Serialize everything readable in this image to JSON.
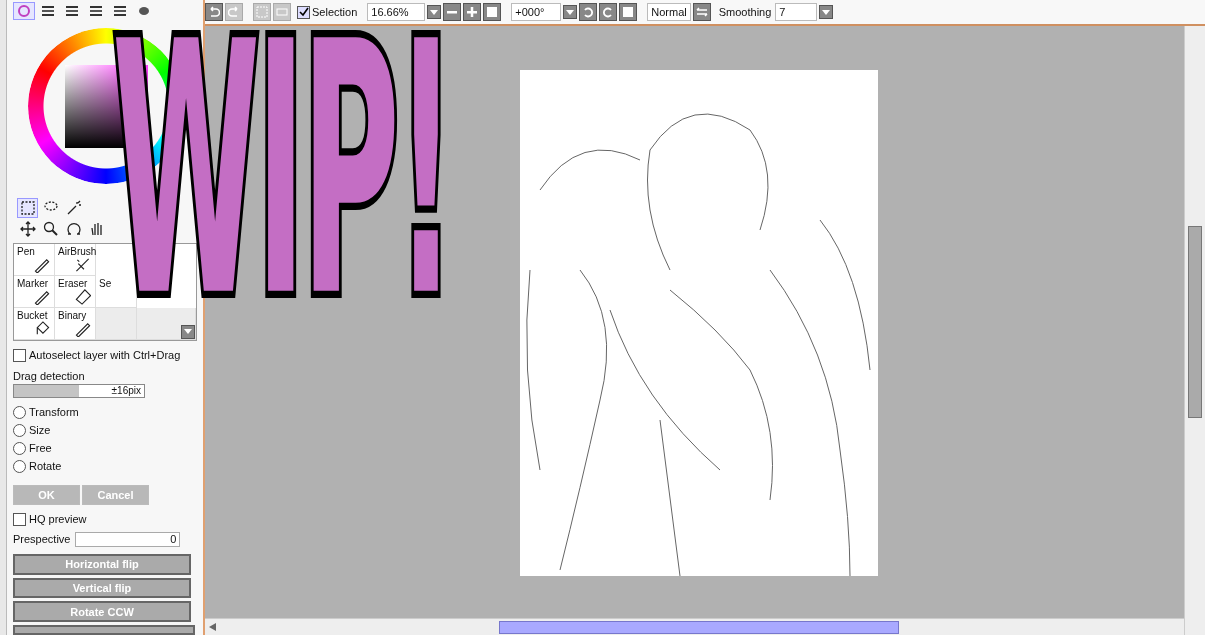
{
  "overlay": {
    "text": "WIP!"
  },
  "color_tabs": [
    {
      "selected": true
    },
    {
      "selected": false
    },
    {
      "selected": false
    },
    {
      "selected": false
    },
    {
      "selected": false
    },
    {
      "selected": false
    }
  ],
  "select_tools": [
    {
      "selected": true
    },
    {
      "selected": false
    },
    {
      "selected": false
    },
    {
      "selected": false
    },
    {
      "selected": false
    },
    {
      "selected": false
    },
    {
      "selected": false
    }
  ],
  "brushes": [
    {
      "label": "Pen",
      "kind": "pen"
    },
    {
      "label": "AirBrush",
      "kind": "airbrush"
    },
    {
      "kind": "none"
    },
    {
      "kind": "none"
    },
    {
      "label": "Marker",
      "kind": "marker"
    },
    {
      "label": "Eraser",
      "kind": "eraser"
    },
    {
      "label": "Se",
      "kind": "none"
    },
    {
      "kind": "none"
    },
    {
      "label": "Bucket",
      "kind": "bucket"
    },
    {
      "label": "Binary",
      "kind": "binary"
    },
    {
      "kind": "empty"
    },
    {
      "kind": "empty"
    }
  ],
  "autoselect": {
    "label": "Autoselect layer with Ctrl+Drag",
    "checked": false
  },
  "drag_detection": {
    "label": "Drag detection",
    "level": 0.5,
    "reading": "±16pix"
  },
  "modes": [
    {
      "label": "Transform",
      "selected": false
    },
    {
      "label": "Size",
      "selected": false
    },
    {
      "label": "Free",
      "selected": false
    },
    {
      "label": "Rotate",
      "selected": false
    }
  ],
  "confirm_buttons": [
    {
      "label": "OK",
      "disabled": true
    },
    {
      "label": "Cancel",
      "disabled": true
    }
  ],
  "hq_preview": {
    "label": "HQ preview",
    "checked": false
  },
  "perspective": {
    "label": "Prespective",
    "value": "0"
  },
  "action_buttons": [
    "Horizontal flip",
    "Vertical flip",
    "Rotate CCW"
  ],
  "toolbar": {
    "selection": {
      "label": "Selection",
      "checked": true
    },
    "zoom": "16.66%",
    "angle": "+000°",
    "blend": "Normal",
    "smoothing_label": "Smoothing",
    "smoothing": "7"
  }
}
